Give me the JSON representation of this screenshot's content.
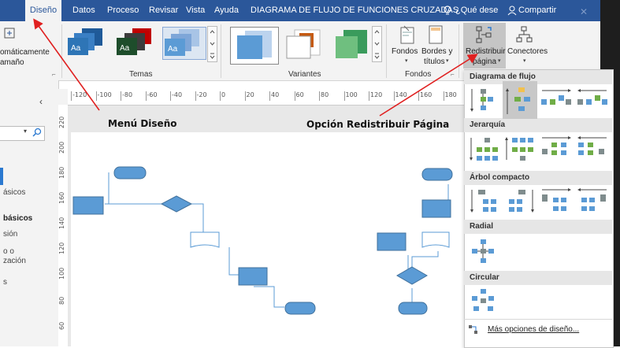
{
  "tabs": [
    {
      "label": "Diseño",
      "active": true
    },
    {
      "label": "Datos"
    },
    {
      "label": "Proceso"
    },
    {
      "label": "Revisar"
    },
    {
      "label": "Vista"
    },
    {
      "label": "Ayuda"
    }
  ],
  "document_title": "DIAGRAMA DE FLUJO DE FUNCIONES CRUZADAS",
  "tell_me": "¿Qué dese",
  "share": "Compartir",
  "ribbon": {
    "autosize_label_1": "omáticamente",
    "autosize_label_2": "amaño",
    "group_temas": "Temas",
    "group_variantes": "Variantes",
    "group_fondos": "Fondos",
    "btn_fondos": "Fondos",
    "btn_bordes_1": "Bordes y",
    "btn_bordes_2": "títulos",
    "btn_redistribuir_1": "Redistribuir",
    "btn_redistribuir_2": "página",
    "btn_conectores": "Conectores",
    "theme_label": "Aa"
  },
  "left_panel": {
    "items": [
      "ásicos",
      "básicos",
      "sión",
      "o o",
      "zación",
      "s"
    ]
  },
  "ruler": {
    "h_ticks": [
      "-120",
      "-100",
      "-80",
      "-60",
      "-40",
      "-20",
      "0",
      "20",
      "40",
      "60",
      "80",
      "100",
      "120",
      "140",
      "160",
      "180"
    ],
    "v_ticks": [
      "220",
      "200",
      "180",
      "160",
      "140",
      "120",
      "100",
      "80",
      "60"
    ]
  },
  "annotations": {
    "menu": "Menú Diseño",
    "option": "Opción Redistribuir Página"
  },
  "gallery": {
    "sections": [
      "Diagrama de flujo",
      "Jerarquía",
      "Árbol compacto",
      "Radial",
      "Circular"
    ],
    "more": "Más opciones de diseño..."
  },
  "colors": {
    "tabbar": "#2b579a",
    "shape_fill": "#5b9bd5",
    "shape_stroke": "#41719c",
    "arrow": "#e02020"
  }
}
